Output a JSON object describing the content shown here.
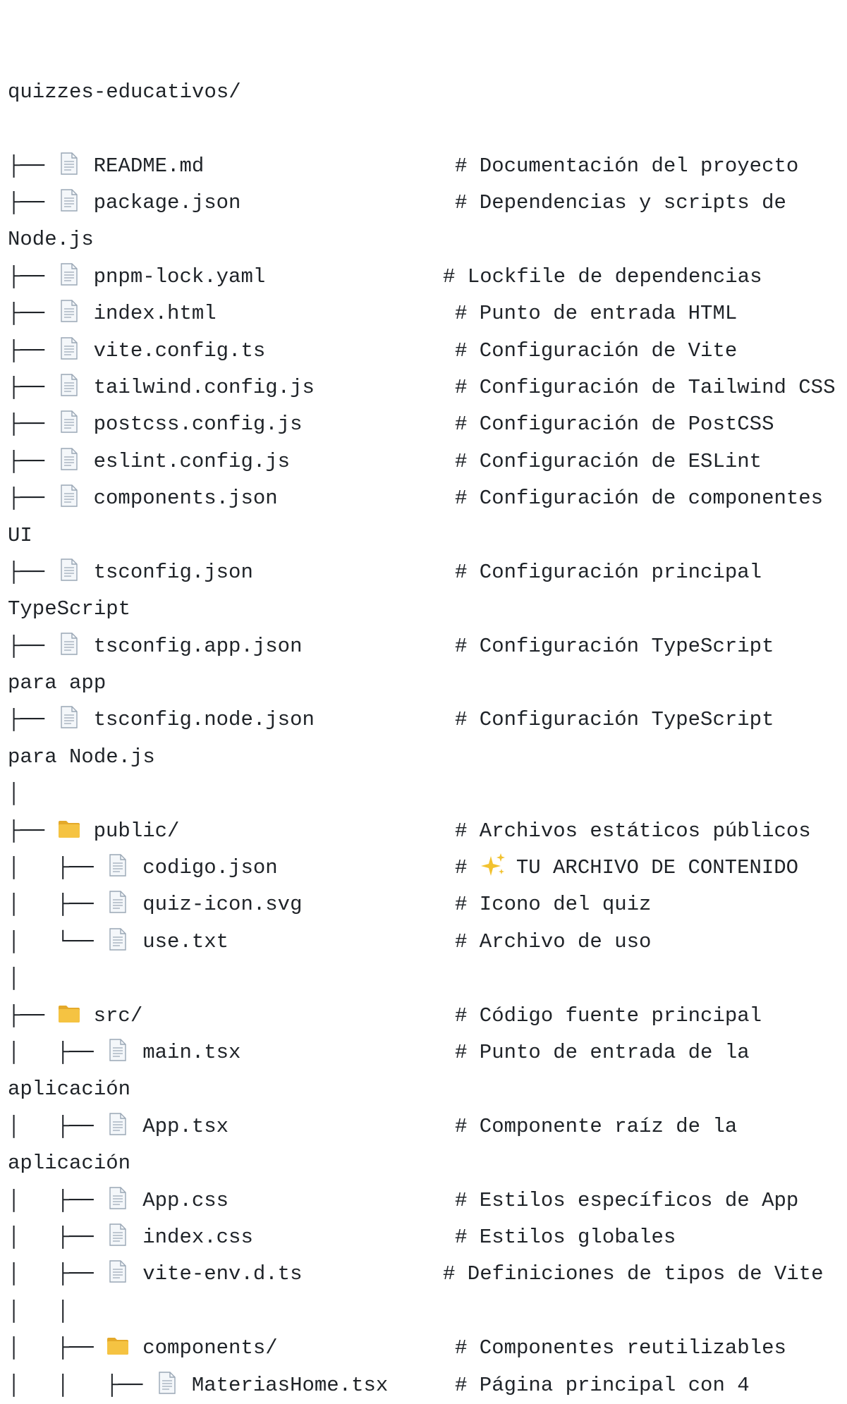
{
  "root": "quizzes-educativos/",
  "icons": {
    "file": "file-icon",
    "folder": "folder-icon",
    "sparkle": "sparkles-icon"
  },
  "colors": {
    "folder": "#F5C342",
    "file_outline": "#9AA7B5",
    "file_fill": "#F4F7FA",
    "sparkle": "#F2C230",
    "text": "#1F2328"
  },
  "lines": [
    {
      "kind": "entry",
      "prefix": "├── ",
      "icon": "file",
      "name": "README.md",
      "comment": "# Documentación del proyecto"
    },
    {
      "kind": "entry",
      "prefix": "├── ",
      "icon": "file",
      "name": "package.json",
      "comment": "# Dependencias y scripts de"
    },
    {
      "kind": "cont",
      "text": "Node.js"
    },
    {
      "kind": "entry",
      "prefix": "├── ",
      "icon": "file",
      "name": "pnpm-lock.yaml",
      "comment": "# Lockfile de dependencias",
      "shift": true
    },
    {
      "kind": "entry",
      "prefix": "├── ",
      "icon": "file",
      "name": "index.html",
      "comment": "# Punto de entrada HTML"
    },
    {
      "kind": "entry",
      "prefix": "├── ",
      "icon": "file",
      "name": "vite.config.ts",
      "comment": "# Configuración de Vite"
    },
    {
      "kind": "entry",
      "prefix": "├── ",
      "icon": "file",
      "name": "tailwind.config.js",
      "comment": "# Configuración de Tailwind CSS"
    },
    {
      "kind": "entry",
      "prefix": "├── ",
      "icon": "file",
      "name": "postcss.config.js",
      "comment": "# Configuración de PostCSS"
    },
    {
      "kind": "entry",
      "prefix": "├── ",
      "icon": "file",
      "name": "eslint.config.js",
      "comment": "# Configuración de ESLint"
    },
    {
      "kind": "entry",
      "prefix": "├── ",
      "icon": "file",
      "name": "components.json",
      "comment": "# Configuración de componentes"
    },
    {
      "kind": "cont",
      "text": "UI"
    },
    {
      "kind": "entry",
      "prefix": "├── ",
      "icon": "file",
      "name": "tsconfig.json",
      "comment": "# Configuración principal"
    },
    {
      "kind": "cont",
      "text": "TypeScript"
    },
    {
      "kind": "entry",
      "prefix": "├── ",
      "icon": "file",
      "name": "tsconfig.app.json",
      "comment": "# Configuración TypeScript"
    },
    {
      "kind": "cont",
      "text": "para app"
    },
    {
      "kind": "entry",
      "prefix": "├── ",
      "icon": "file",
      "name": "tsconfig.node.json",
      "comment": "# Configuración TypeScript"
    },
    {
      "kind": "cont",
      "text": "para Node.js"
    },
    {
      "kind": "cont",
      "text": "│"
    },
    {
      "kind": "entry",
      "prefix": "├── ",
      "icon": "folder",
      "name": "public/",
      "comment": "# Archivos estáticos públicos"
    },
    {
      "kind": "entry",
      "prefix": "│   ├── ",
      "icon": "file",
      "name": "codigo.json",
      "comment": "TU ARCHIVO DE CONTENIDO",
      "comment_prefix": "# ",
      "sparkle": true
    },
    {
      "kind": "entry",
      "prefix": "│   ├── ",
      "icon": "file",
      "name": "quiz-icon.svg",
      "comment": "# Icono del quiz"
    },
    {
      "kind": "entry",
      "prefix": "│   └── ",
      "icon": "file",
      "name": "use.txt",
      "comment": "# Archivo de uso"
    },
    {
      "kind": "cont",
      "text": "│"
    },
    {
      "kind": "entry",
      "prefix": "├── ",
      "icon": "folder",
      "name": "src/",
      "comment": "# Código fuente principal"
    },
    {
      "kind": "entry",
      "prefix": "│   ├── ",
      "icon": "file",
      "name": "main.tsx",
      "comment": "# Punto de entrada de la"
    },
    {
      "kind": "cont",
      "text": "aplicación"
    },
    {
      "kind": "entry",
      "prefix": "│   ├── ",
      "icon": "file",
      "name": "App.tsx",
      "comment": "# Componente raíz de la"
    },
    {
      "kind": "cont",
      "text": "aplicación"
    },
    {
      "kind": "entry",
      "prefix": "│   ├── ",
      "icon": "file",
      "name": "App.css",
      "comment": "# Estilos específicos de App"
    },
    {
      "kind": "entry",
      "prefix": "│   ├── ",
      "icon": "file",
      "name": "index.css",
      "comment": "# Estilos globales"
    },
    {
      "kind": "entry",
      "prefix": "│   ├── ",
      "icon": "file",
      "name": "vite-env.d.ts",
      "comment": "# Definiciones de tipos de Vite",
      "shift": true
    },
    {
      "kind": "cont",
      "text": "│   │"
    },
    {
      "kind": "entry",
      "prefix": "│   ├── ",
      "icon": "folder",
      "name": "components/",
      "comment": "# Componentes reutilizables"
    },
    {
      "kind": "entry",
      "prefix": "│   │   ├── ",
      "icon": "file",
      "name": "MateriasHome.tsx",
      "comment": "# Página principal con 4"
    }
  ]
}
